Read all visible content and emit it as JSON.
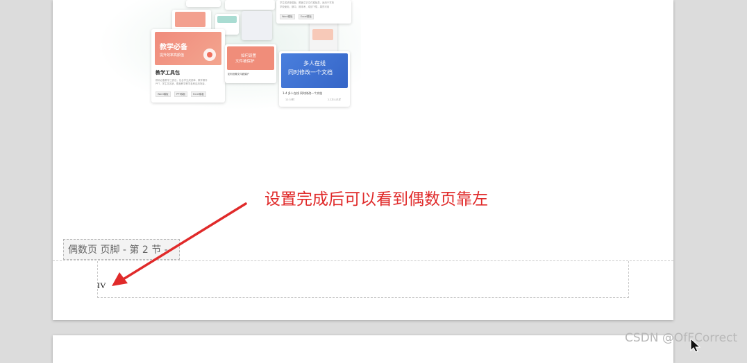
{
  "document": {
    "illustration": {
      "card_teaching": {
        "banner_line1": "教学必备",
        "banner_line2": "提升效率高颜值",
        "title": "教学工具包",
        "desc_line1": "教师必备教学工具包，包含学生成绩单、教学课件",
        "desc_line2": "PPT、学生花名册，覆盖教学教学各种应用场景。",
        "tags": [
          "Word模板",
          "PPT模板",
          "Excel模板"
        ]
      },
      "card_protect": {
        "banner_line1": "如何设置",
        "banner_line2": "文件被保护",
        "title": "如何设置文件被保护"
      },
      "card_collab": {
        "banner_line1": "多人在线",
        "banner_line2": "同时修改一个文档",
        "title": "1-4 多人在线 同时修改一个文档",
        "meta_left": "12:35时",
        "meta_right": "2.2万人已学"
      },
      "card_top_right": {
        "desc_line1": "学生成绩单模板，覆盖文字文件模板类，适用于学校",
        "desc_line2": "学校使用，期中、期末考、成绩下载，果然可用",
        "tags": [
          "Word模板",
          "Excel模板"
        ]
      }
    },
    "footer_label": "偶数页 页脚  - 第 2 节 -",
    "page_number": "IV"
  },
  "annotation": {
    "text": "设置完成后可以看到偶数页靠左",
    "color": "#e02a2a"
  },
  "watermark": "CSDN @OfFCorrect"
}
